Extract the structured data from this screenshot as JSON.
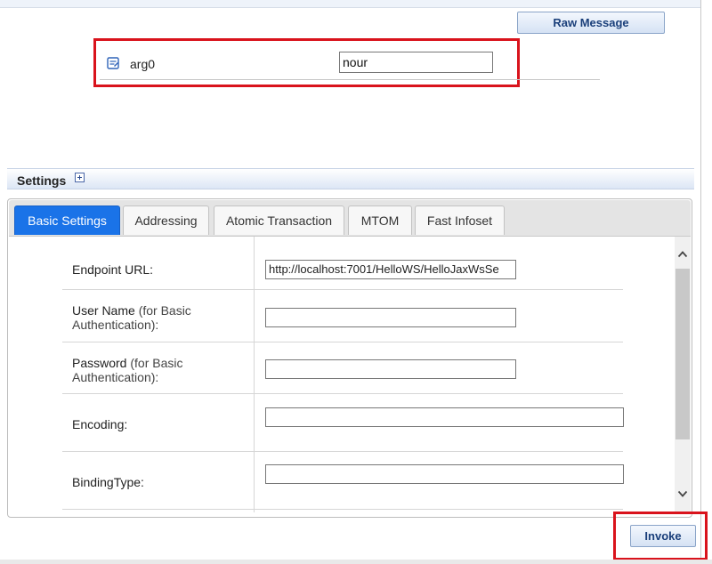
{
  "top": {
    "raw_message_label": "Raw Message"
  },
  "param": {
    "name": "arg0",
    "value": "nour"
  },
  "settings": {
    "title": "Settings"
  },
  "tabs": [
    {
      "label": "Basic Settings",
      "active": true
    },
    {
      "label": "Addressing",
      "active": false
    },
    {
      "label": "Atomic Transaction",
      "active": false
    },
    {
      "label": "MTOM",
      "active": false
    },
    {
      "label": "Fast Infoset",
      "active": false
    }
  ],
  "form": {
    "endpoint_label": "Endpoint URL:",
    "endpoint_value": "http://localhost:7001/HelloWS/HelloJaxWsSe",
    "username_label": "User Name",
    "username_hint": "(for Basic",
    "username_hint2": "Authentication):",
    "password_label": "Password",
    "password_hint": "(for Basic",
    "password_hint2": "Authentication):",
    "encoding_label": "Encoding:",
    "bindingtype_label": "BindingType:"
  },
  "footer": {
    "invoke_label": "Invoke"
  },
  "colors": {
    "accent": "#1a73e8",
    "highlight": "#d9131c"
  }
}
